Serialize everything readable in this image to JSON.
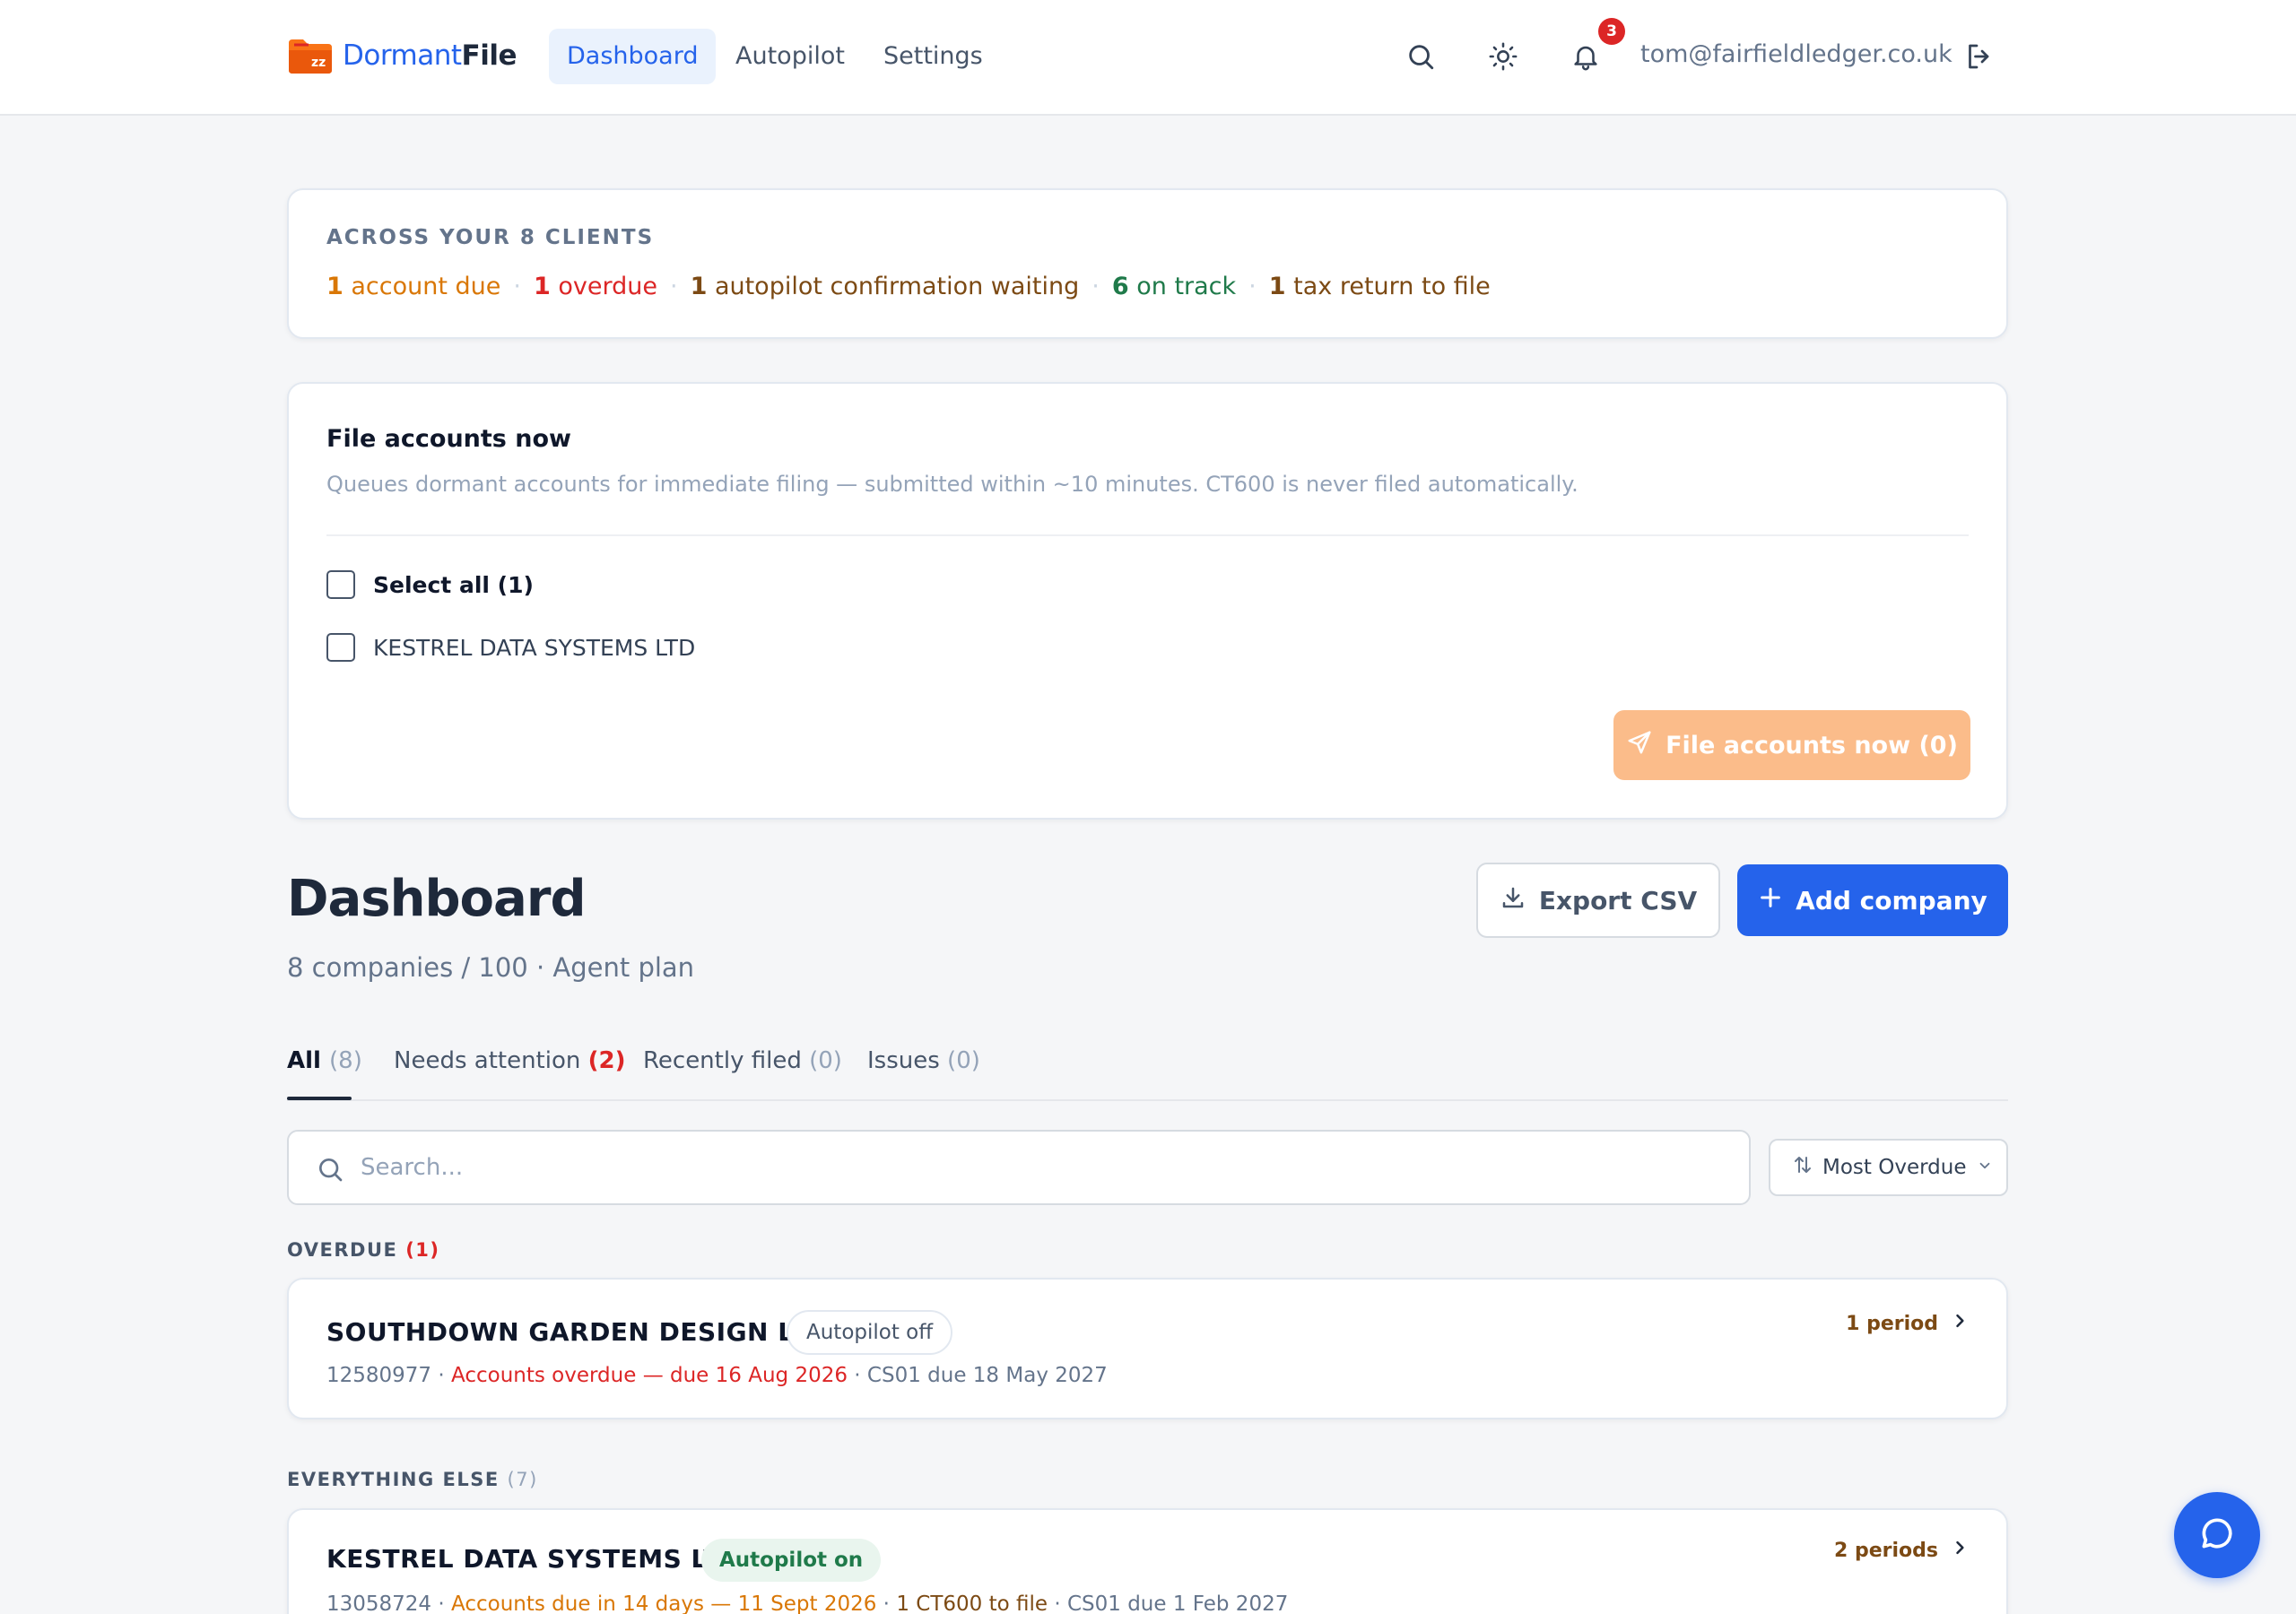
{
  "colors": {
    "accent": "#2563eb",
    "danger": "#dc2626",
    "warning": "#d97706",
    "success": "#1f7a4a",
    "muted_brown": "#7c4a14",
    "disabled_orange": "#fbbc8a"
  },
  "header": {
    "logo": {
      "part1": "Dormant",
      "part2": "File",
      "icon": "folder-zz-icon"
    },
    "nav": [
      {
        "label": "Dashboard",
        "active": true
      },
      {
        "label": "Autopilot",
        "active": false
      },
      {
        "label": "Settings",
        "active": false
      }
    ],
    "icons": [
      "search-icon",
      "sun-icon",
      "bell-icon",
      "logout-icon"
    ],
    "notification_count": "3",
    "user_email": "tom@fairfieldledger.co.uk"
  },
  "summary": {
    "heading": "ACROSS YOUR 8 CLIENTS",
    "items": [
      {
        "num": "1",
        "text": " account due"
      },
      {
        "num": "1",
        "text": " overdue"
      },
      {
        "num": "1",
        "text": " autopilot confirmation waiting"
      },
      {
        "num": "6",
        "text": " on track"
      },
      {
        "num": "1",
        "text": " tax return to file"
      }
    ],
    "separator": "·"
  },
  "file_accounts": {
    "title": "File accounts now",
    "description": "Queues dormant accounts for immediate filing — submitted within ~10 minutes. CT600 is never filed automatically.",
    "select_all_label": "Select all (1)",
    "companies": [
      "KESTREL DATA SYSTEMS LTD"
    ],
    "button_label": "File accounts now (0)",
    "button_icon": "send-icon"
  },
  "dashboard": {
    "title": "Dashboard",
    "subtitle": "8 companies / 100 · Agent plan",
    "export_label": "Export CSV",
    "add_label": "Add company"
  },
  "tabs": [
    {
      "label": "All",
      "count": "(8)",
      "active": true
    },
    {
      "label": "Needs attention",
      "count": "(2)",
      "active": false
    },
    {
      "label": "Recently filed",
      "count": "(0)",
      "active": false
    },
    {
      "label": "Issues",
      "count": "(0)",
      "active": false
    }
  ],
  "search": {
    "placeholder": "Search...",
    "value": ""
  },
  "sort": {
    "selected": "Most Overdue"
  },
  "sections": {
    "overdue": {
      "label": "OVERDUE",
      "count": "(1)"
    },
    "everything_else": {
      "label": "EVERYTHING ELSE",
      "count": "(7)"
    }
  },
  "companies": [
    {
      "name": "SOUTHDOWN GARDEN DESIGN LTD",
      "autopilot": "Autopilot off",
      "number": "12580977",
      "sep": " · ",
      "status": "Accounts overdue — due 16 Aug 2026",
      "cs01": "CS01 due 18 May 2027",
      "periods": "1 period"
    },
    {
      "name": "KESTREL DATA SYSTEMS LTD",
      "autopilot": "Autopilot on",
      "number": "13058724",
      "sep": " · ",
      "status": "Accounts due in 14 days — 11 Sept 2026",
      "ct600": "1 CT600 to file",
      "cs01": "CS01 due 1 Feb 2027",
      "periods": "2 periods"
    }
  ]
}
